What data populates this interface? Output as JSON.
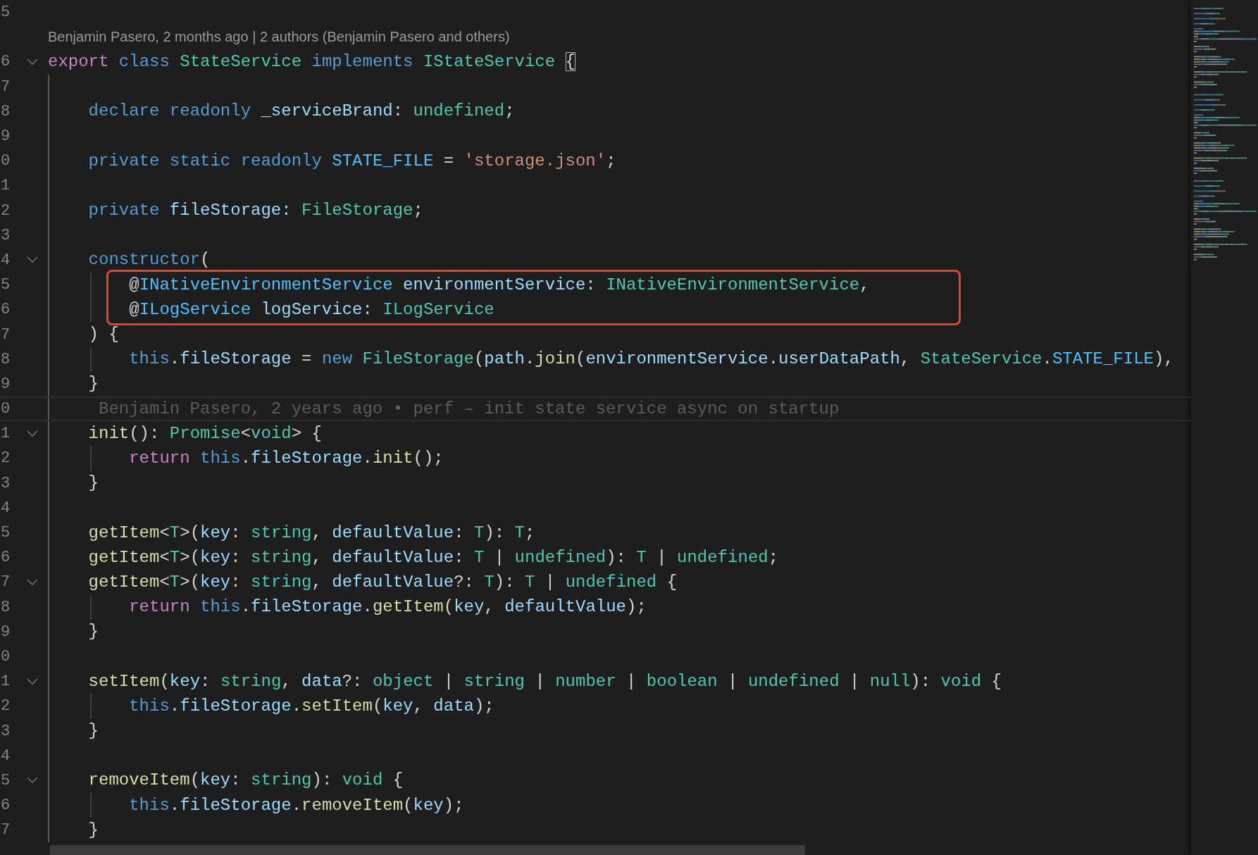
{
  "editor": {
    "lines": [
      {
        "kind": "code",
        "number": "5",
        "fold": false,
        "boxed": false
      },
      {
        "kind": "codelens",
        "text": "Benjamin Pasero, 2 months ago | 2 authors (Benjamin Pasero and others)"
      },
      {
        "kind": "code",
        "number": "6",
        "fold": true,
        "boxed": false,
        "tokens": [
          {
            "kind": "control",
            "text": "export "
          },
          {
            "kind": "keyword",
            "text": "class "
          },
          {
            "kind": "type",
            "text": "StateService "
          },
          {
            "kind": "keyword",
            "text": "implements "
          },
          {
            "kind": "type",
            "text": "IStateService "
          },
          {
            "kind": "bracket-match",
            "text": "{"
          }
        ]
      },
      {
        "kind": "code",
        "number": "7",
        "fold": false,
        "boxed": false
      },
      {
        "kind": "code",
        "number": "8",
        "fold": false,
        "boxed": false,
        "tokens": [
          {
            "kind": "keyword",
            "text": "    declare readonly "
          },
          {
            "kind": "variable",
            "text": "_serviceBrand"
          },
          {
            "kind": "plain",
            "text": ": "
          },
          {
            "kind": "type",
            "text": "undefined"
          },
          {
            "kind": "plain",
            "text": ";"
          }
        ]
      },
      {
        "kind": "code",
        "number": "9",
        "fold": false,
        "boxed": false
      },
      {
        "kind": "code",
        "number": "0",
        "fold": false,
        "boxed": false,
        "tokens": [
          {
            "kind": "keyword",
            "text": "    private static readonly "
          },
          {
            "kind": "constant",
            "text": "STATE_FILE"
          },
          {
            "kind": "plain",
            "text": " = "
          },
          {
            "kind": "string",
            "text": "'storage.json'"
          },
          {
            "kind": "plain",
            "text": ";"
          }
        ]
      },
      {
        "kind": "code",
        "number": "1",
        "fold": false,
        "boxed": false
      },
      {
        "kind": "code",
        "number": "2",
        "fold": false,
        "boxed": false,
        "tokens": [
          {
            "kind": "keyword",
            "text": "    private "
          },
          {
            "kind": "variable",
            "text": "fileStorage"
          },
          {
            "kind": "plain",
            "text": ": "
          },
          {
            "kind": "type",
            "text": "FileStorage"
          },
          {
            "kind": "plain",
            "text": ";"
          }
        ]
      },
      {
        "kind": "code",
        "number": "3",
        "fold": false,
        "boxed": false
      },
      {
        "kind": "code",
        "number": "4",
        "fold": true,
        "boxed": false,
        "tokens": [
          {
            "kind": "keyword",
            "text": "    constructor"
          },
          {
            "kind": "plain",
            "text": "("
          }
        ]
      },
      {
        "kind": "code",
        "number": "5",
        "fold": false,
        "boxed": true,
        "tokens": [
          {
            "kind": "plain",
            "text": "        @"
          },
          {
            "kind": "constant",
            "text": "INativeEnvironmentService "
          },
          {
            "kind": "variable",
            "text": "environmentService"
          },
          {
            "kind": "plain",
            "text": ": "
          },
          {
            "kind": "type",
            "text": "INativeEnvironmentService"
          },
          {
            "kind": "plain",
            "text": ","
          }
        ]
      },
      {
        "kind": "code",
        "number": "6",
        "fold": false,
        "boxed": true,
        "tokens": [
          {
            "kind": "plain",
            "text": "        @"
          },
          {
            "kind": "constant",
            "text": "ILogService "
          },
          {
            "kind": "variable",
            "text": "logService"
          },
          {
            "kind": "plain",
            "text": ": "
          },
          {
            "kind": "type",
            "text": "ILogService"
          }
        ]
      },
      {
        "kind": "code",
        "number": "7",
        "fold": false,
        "boxed": false,
        "tokens": [
          {
            "kind": "plain",
            "text": "    ) {"
          }
        ]
      },
      {
        "kind": "code",
        "number": "8",
        "fold": false,
        "boxed": false,
        "tokens": [
          {
            "kind": "keyword",
            "text": "        this"
          },
          {
            "kind": "plain",
            "text": "."
          },
          {
            "kind": "variable",
            "text": "fileStorage"
          },
          {
            "kind": "plain",
            "text": " = "
          },
          {
            "kind": "keyword",
            "text": "new "
          },
          {
            "kind": "type",
            "text": "FileStorage"
          },
          {
            "kind": "plain",
            "text": "("
          },
          {
            "kind": "variable",
            "text": "path"
          },
          {
            "kind": "plain",
            "text": "."
          },
          {
            "kind": "function",
            "text": "join"
          },
          {
            "kind": "plain",
            "text": "("
          },
          {
            "kind": "variable",
            "text": "environmentService"
          },
          {
            "kind": "plain",
            "text": "."
          },
          {
            "kind": "variable",
            "text": "userDataPath"
          },
          {
            "kind": "plain",
            "text": ", "
          },
          {
            "kind": "type",
            "text": "StateService"
          },
          {
            "kind": "plain",
            "text": "."
          },
          {
            "kind": "constant",
            "text": "STATE_FILE"
          },
          {
            "kind": "plain",
            "text": "),"
          }
        ]
      },
      {
        "kind": "code",
        "number": "9",
        "fold": false,
        "boxed": false,
        "tokens": [
          {
            "kind": "plain",
            "text": "    }"
          }
        ]
      },
      {
        "kind": "blame",
        "number": "0",
        "text": "Benjamin Pasero, 2 years ago • perf – init state service async on startup"
      },
      {
        "kind": "code",
        "number": "1",
        "fold": true,
        "boxed": false,
        "tokens": [
          {
            "kind": "function",
            "text": "    init"
          },
          {
            "kind": "plain",
            "text": "(): "
          },
          {
            "kind": "type",
            "text": "Promise"
          },
          {
            "kind": "plain",
            "text": "<"
          },
          {
            "kind": "type",
            "text": "void"
          },
          {
            "kind": "plain",
            "text": "> {"
          }
        ]
      },
      {
        "kind": "code",
        "number": "2",
        "fold": false,
        "boxed": false,
        "tokens": [
          {
            "kind": "control",
            "text": "        return "
          },
          {
            "kind": "keyword",
            "text": "this"
          },
          {
            "kind": "plain",
            "text": "."
          },
          {
            "kind": "variable",
            "text": "fileStorage"
          },
          {
            "kind": "plain",
            "text": "."
          },
          {
            "kind": "function",
            "text": "init"
          },
          {
            "kind": "plain",
            "text": "();"
          }
        ]
      },
      {
        "kind": "code",
        "number": "3",
        "fold": false,
        "boxed": false,
        "tokens": [
          {
            "kind": "plain",
            "text": "    }"
          }
        ]
      },
      {
        "kind": "code",
        "number": "4",
        "fold": false,
        "boxed": false
      },
      {
        "kind": "code",
        "number": "5",
        "fold": false,
        "boxed": false,
        "tokens": [
          {
            "kind": "function",
            "text": "    getItem"
          },
          {
            "kind": "plain",
            "text": "<"
          },
          {
            "kind": "type",
            "text": "T"
          },
          {
            "kind": "plain",
            "text": ">("
          },
          {
            "kind": "variable",
            "text": "key"
          },
          {
            "kind": "plain",
            "text": ": "
          },
          {
            "kind": "type",
            "text": "string"
          },
          {
            "kind": "plain",
            "text": ", "
          },
          {
            "kind": "variable",
            "text": "defaultValue"
          },
          {
            "kind": "plain",
            "text": ": "
          },
          {
            "kind": "type",
            "text": "T"
          },
          {
            "kind": "plain",
            "text": "): "
          },
          {
            "kind": "type",
            "text": "T"
          },
          {
            "kind": "plain",
            "text": ";"
          }
        ]
      },
      {
        "kind": "code",
        "number": "6",
        "fold": false,
        "boxed": false,
        "tokens": [
          {
            "kind": "function",
            "text": "    getItem"
          },
          {
            "kind": "plain",
            "text": "<"
          },
          {
            "kind": "type",
            "text": "T"
          },
          {
            "kind": "plain",
            "text": ">("
          },
          {
            "kind": "variable",
            "text": "key"
          },
          {
            "kind": "plain",
            "text": ": "
          },
          {
            "kind": "type",
            "text": "string"
          },
          {
            "kind": "plain",
            "text": ", "
          },
          {
            "kind": "variable",
            "text": "defaultValue"
          },
          {
            "kind": "plain",
            "text": ": "
          },
          {
            "kind": "type",
            "text": "T"
          },
          {
            "kind": "plain",
            "text": " | "
          },
          {
            "kind": "type",
            "text": "undefined"
          },
          {
            "kind": "plain",
            "text": "): "
          },
          {
            "kind": "type",
            "text": "T"
          },
          {
            "kind": "plain",
            "text": " | "
          },
          {
            "kind": "type",
            "text": "undefined"
          },
          {
            "kind": "plain",
            "text": ";"
          }
        ]
      },
      {
        "kind": "code",
        "number": "7",
        "fold": true,
        "boxed": false,
        "tokens": [
          {
            "kind": "function",
            "text": "    getItem"
          },
          {
            "kind": "plain",
            "text": "<"
          },
          {
            "kind": "type",
            "text": "T"
          },
          {
            "kind": "plain",
            "text": ">("
          },
          {
            "kind": "variable",
            "text": "key"
          },
          {
            "kind": "plain",
            "text": ": "
          },
          {
            "kind": "type",
            "text": "string"
          },
          {
            "kind": "plain",
            "text": ", "
          },
          {
            "kind": "variable",
            "text": "defaultValue"
          },
          {
            "kind": "plain",
            "text": "?: "
          },
          {
            "kind": "type",
            "text": "T"
          },
          {
            "kind": "plain",
            "text": "): "
          },
          {
            "kind": "type",
            "text": "T"
          },
          {
            "kind": "plain",
            "text": " | "
          },
          {
            "kind": "type",
            "text": "undefined"
          },
          {
            "kind": "plain",
            "text": " {"
          }
        ]
      },
      {
        "kind": "code",
        "number": "8",
        "fold": false,
        "boxed": false,
        "tokens": [
          {
            "kind": "control",
            "text": "        return "
          },
          {
            "kind": "keyword",
            "text": "this"
          },
          {
            "kind": "plain",
            "text": "."
          },
          {
            "kind": "variable",
            "text": "fileStorage"
          },
          {
            "kind": "plain",
            "text": "."
          },
          {
            "kind": "function",
            "text": "getItem"
          },
          {
            "kind": "plain",
            "text": "("
          },
          {
            "kind": "variable",
            "text": "key"
          },
          {
            "kind": "plain",
            "text": ", "
          },
          {
            "kind": "variable",
            "text": "defaultValue"
          },
          {
            "kind": "plain",
            "text": ");"
          }
        ]
      },
      {
        "kind": "code",
        "number": "9",
        "fold": false,
        "boxed": false,
        "tokens": [
          {
            "kind": "plain",
            "text": "    }"
          }
        ]
      },
      {
        "kind": "code",
        "number": "0",
        "fold": false,
        "boxed": false
      },
      {
        "kind": "code",
        "number": "1",
        "fold": true,
        "boxed": false,
        "tokens": [
          {
            "kind": "function",
            "text": "    setItem"
          },
          {
            "kind": "plain",
            "text": "("
          },
          {
            "kind": "variable",
            "text": "key"
          },
          {
            "kind": "plain",
            "text": ": "
          },
          {
            "kind": "type",
            "text": "string"
          },
          {
            "kind": "plain",
            "text": ", "
          },
          {
            "kind": "variable",
            "text": "data"
          },
          {
            "kind": "plain",
            "text": "?: "
          },
          {
            "kind": "type",
            "text": "object"
          },
          {
            "kind": "plain",
            "text": " | "
          },
          {
            "kind": "type",
            "text": "string"
          },
          {
            "kind": "plain",
            "text": " | "
          },
          {
            "kind": "type",
            "text": "number"
          },
          {
            "kind": "plain",
            "text": " | "
          },
          {
            "kind": "type",
            "text": "boolean"
          },
          {
            "kind": "plain",
            "text": " | "
          },
          {
            "kind": "type",
            "text": "undefined"
          },
          {
            "kind": "plain",
            "text": " | "
          },
          {
            "kind": "type",
            "text": "null"
          },
          {
            "kind": "plain",
            "text": "): "
          },
          {
            "kind": "type",
            "text": "void"
          },
          {
            "kind": "plain",
            "text": " {"
          }
        ]
      },
      {
        "kind": "code",
        "number": "2",
        "fold": false,
        "boxed": false,
        "tokens": [
          {
            "kind": "keyword",
            "text": "        this"
          },
          {
            "kind": "plain",
            "text": "."
          },
          {
            "kind": "variable",
            "text": "fileStorage"
          },
          {
            "kind": "plain",
            "text": "."
          },
          {
            "kind": "function",
            "text": "setItem"
          },
          {
            "kind": "plain",
            "text": "("
          },
          {
            "kind": "variable",
            "text": "key"
          },
          {
            "kind": "plain",
            "text": ", "
          },
          {
            "kind": "variable",
            "text": "data"
          },
          {
            "kind": "plain",
            "text": ");"
          }
        ]
      },
      {
        "kind": "code",
        "number": "3",
        "fold": false,
        "boxed": false,
        "tokens": [
          {
            "kind": "plain",
            "text": "    }"
          }
        ]
      },
      {
        "kind": "code",
        "number": "4",
        "fold": false,
        "boxed": false
      },
      {
        "kind": "code",
        "number": "5",
        "fold": true,
        "boxed": false,
        "tokens": [
          {
            "kind": "function",
            "text": "    removeItem"
          },
          {
            "kind": "plain",
            "text": "("
          },
          {
            "kind": "variable",
            "text": "key"
          },
          {
            "kind": "plain",
            "text": ": "
          },
          {
            "kind": "type",
            "text": "string"
          },
          {
            "kind": "plain",
            "text": "): "
          },
          {
            "kind": "type",
            "text": "void"
          },
          {
            "kind": "plain",
            "text": " {"
          }
        ]
      },
      {
        "kind": "code",
        "number": "6",
        "fold": false,
        "boxed": false,
        "tokens": [
          {
            "kind": "keyword",
            "text": "        this"
          },
          {
            "kind": "plain",
            "text": "."
          },
          {
            "kind": "variable",
            "text": "fileStorage"
          },
          {
            "kind": "plain",
            "text": "."
          },
          {
            "kind": "function",
            "text": "removeItem"
          },
          {
            "kind": "plain",
            "text": "("
          },
          {
            "kind": "variable",
            "text": "key"
          },
          {
            "kind": "plain",
            "text": ");"
          }
        ]
      },
      {
        "kind": "code",
        "number": "7",
        "fold": false,
        "boxed": false,
        "tokens": [
          {
            "kind": "plain",
            "text": "    }"
          }
        ]
      }
    ]
  }
}
